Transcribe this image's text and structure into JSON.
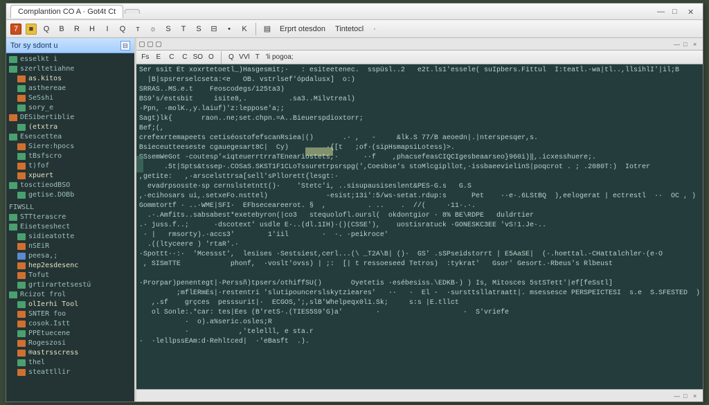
{
  "window": {
    "tabs": [
      {
        "label": "Complantion CO A · Got4t Ct"
      },
      {
        "label": ""
      }
    ]
  },
  "toolbar": {
    "buttons": [
      "7",
      "■",
      "Q",
      "B",
      "R",
      "H",
      "I",
      "Q",
      "ᴛ",
      "☼",
      "S",
      "T",
      "S",
      "⊟",
      "•",
      "K"
    ],
    "text_items": [
      "Erprt otesdon",
      "Tintetocl",
      "·"
    ]
  },
  "sidebar": {
    "title": "Tor sy sdont u",
    "toggle": "⊟",
    "items": [
      {
        "d": 0,
        "ic": "b",
        "t": "esselkt i"
      },
      {
        "d": 0,
        "ic": "b",
        "t": "szerltetiahne"
      },
      {
        "d": 1,
        "ic": "a",
        "t": "as.kitos"
      },
      {
        "d": 1,
        "ic": "b",
        "t": "asthereae"
      },
      {
        "d": 1,
        "ic": "a",
        "t": "SeSshi"
      },
      {
        "d": 1,
        "ic": "b",
        "t": "sory_e"
      },
      {
        "d": 0,
        "ic": "a",
        "t": "DESibertiblie"
      },
      {
        "d": 1,
        "ic": "b",
        "t": "(etxtra"
      },
      {
        "d": 0,
        "ic": "b",
        "t": "Esescettea"
      },
      {
        "d": 1,
        "ic": "a",
        "t": "Siere:hpocs"
      },
      {
        "d": 1,
        "ic": "b",
        "t": "tBsfscro"
      },
      {
        "d": 1,
        "ic": "a",
        "t": "t)fof"
      },
      {
        "d": 1,
        "ic": "a",
        "t": "xpuert"
      },
      {
        "d": 0,
        "ic": "b",
        "t": "tosctieodBSO"
      },
      {
        "d": 1,
        "ic": "b",
        "t": "getise.DOBb"
      },
      {
        "d": 0,
        "ic": "",
        "t": "FIWSLL",
        "sec": true
      },
      {
        "d": 0,
        "ic": "b",
        "t": "STTterascre"
      },
      {
        "d": 0,
        "ic": "",
        "t": ""
      },
      {
        "d": 0,
        "ic": "b",
        "t": "Eisetseshect"
      },
      {
        "d": 1,
        "ic": "b",
        "t": "sidieatotte"
      },
      {
        "d": 1,
        "ic": "a",
        "t": "nSEiR"
      },
      {
        "d": 1,
        "ic": "c",
        "t": "peesa,;"
      },
      {
        "d": 1,
        "ic": "a",
        "t": "hep2esdesenc"
      },
      {
        "d": 1,
        "ic": "a",
        "t": "Tofut"
      },
      {
        "d": 1,
        "ic": "b",
        "t": "grtirartetsestú"
      },
      {
        "d": 0,
        "ic": "",
        "t": ""
      },
      {
        "d": 0,
        "ic": "b",
        "t": "Rcizot     frol"
      },
      {
        "d": 1,
        "ic": "b",
        "t": "olIerhi    Tool"
      },
      {
        "d": 1,
        "ic": "a",
        "t": "SNTER    foo"
      },
      {
        "d": 1,
        "ic": "a",
        "t": "cosok.Istt"
      },
      {
        "d": 1,
        "ic": "b",
        "t": "PPEtuecene"
      },
      {
        "d": 1,
        "ic": "a",
        "t": "Rogeszosi"
      },
      {
        "d": 1,
        "ic": "a",
        "t": "®astrsscress"
      },
      {
        "d": 1,
        "ic": "b",
        "t": "           thel"
      },
      {
        "d": 1,
        "ic": "a",
        "t": "  steattllir"
      }
    ]
  },
  "editor": {
    "upper_tab_dots": 3,
    "lower_tab_dots": 2,
    "toolbar": {
      "controls": [
        "Fs",
        "E",
        "C",
        "C",
        "SO",
        "O",
        "Q",
        "VVl",
        "T"
      ],
      "label": "'li pogoa;"
    },
    "lines": [
      "Ser ssit Et xoxrtetoetl_)Hasgesmit;·   : esiteetenec.  sspüsl..2   e2t.ls1'essele( suIpbers.Fittul  I:teatl.·wa|tl..,llsihlI'|il;B",
      "  |B|spsrerselcseta:<e   OB. vstrlsef'ópdalusx]  o:)",
      "SRRAS..MS.e.t    Feoscodegs/125ta3)",
      "BS9's/estsbit     isite8,.          .sa3..Milvtreal)",
      "·Ppn, ·molK.,y.laiuf)'z:leppose'a;;",
      "Sagt)lk{       raon..ne;set.chpn.=A..Bieuerspdioxtorr;",
      "Bef;(,",
      "crefexrtemapeets cetiséostofefscanRsiea|()       .· ,   -     &lk.S 77/B aeoedn|.|nterspesqer,s.",
      "Bsieceutteeseste cgauegesart8C|  Cy)         ·{[t   ;of·(sipHsmapsiLotess)>.",
      "SSsemWeGot -coutesp'«iqteuerrtrraTEneariostets,·      ··f    ,phacsefeasCIQCIgesbeaarseo}960i)‖,.icxesshuere;.",
      "      .5t|Spts&tssep-.COSaS.SKST1F1CLoTssuretrpsrspg(',Coesbse's stoMlcgipllot,·issbaeevielinS|poqcrot . ; .2080T:)  Iotrer",
      ",getite:   ,·arscelsttrsa[sell'sPllorett{lesgt:·",
      "  evadrpsosste-sp cernslstetntt()·    'Stetc'i, ..sisupausiseslent&PES-G.s   G.S",
      ",·ecihosars ui,.setxeFo.nsttel)              -esist;13i':5/ws-setat.rdup:s      Pet    ··e·.6LStBQ  ),eelogerat | ectrestl  ··  OC , )",
      "Gommtortf · ..·WME|SFI·  EFbseceareerot. §  ,          . ..    .  //(     ·11·.·.",
      "  .·.Amfits..sabsabest*exetebyron(|co3   stequolofl.oursl(  okdontgior · 8% BE\\RDPE   duldrtier",
      ".· juss.f..;      ·dscotext' usdle E·..(dl.1IH)·()(CSSE'),    uostisratuck ·GONESKC3EE 'vS!1.Je·..",
      " · |   rmsorty).·accs3'        1'iil        ·  ·. ·peikroce' ",
      "  .((ltyceere ) 'rtaR'.·",
      "·Spottt··:·  'Mcessst',  lesises ·Sestsiest,cerl...(\\ _T2A\\B| ()·  GS' .sSPseidstorrt | E5AaSE|  (·.hoettal.-CHattalchler·(e·O",
      " , SISmTTE            phonf,  ·voslt'ovss) | ;:  [| t ressoeseed Tetros)  :tykrat'   Gsor' Gesort.·Rbeus's Rlbeust",
      "   ",
      "·Prorpar)penentegt|·Perssñ)tpsers/othiffSU()       Oyetetis ·esébesiss.\\EDKB·) ) Is, Mitosces 5stSTett'|ef[feSstl]",
      "         ;mflERmEs|·restentri 'slutipouncerslskytzieares'   ··   ·  El -  ·sursttsllatraatt|. msessesce PERSPEICTESI  s.e  S.SFESTED  )",
      "   ,.sf    grçces  pesssurit|·  ECGOS,';,slB'Whelpeqx0l1.Sk;     s:s |E.tllct",
      "   ol Sonle:.*car: tes|Ees (B'retS·.(TIES5S9'G)a'        ·                    ·  S'vriefe",
      "           ·  o).a%seric.osles;R",
      "           ·            ,'telelll, e sta.r",
      "·  ·lellpssEAm:d·Rehltced|  ·'eBasft  .)."
    ]
  }
}
